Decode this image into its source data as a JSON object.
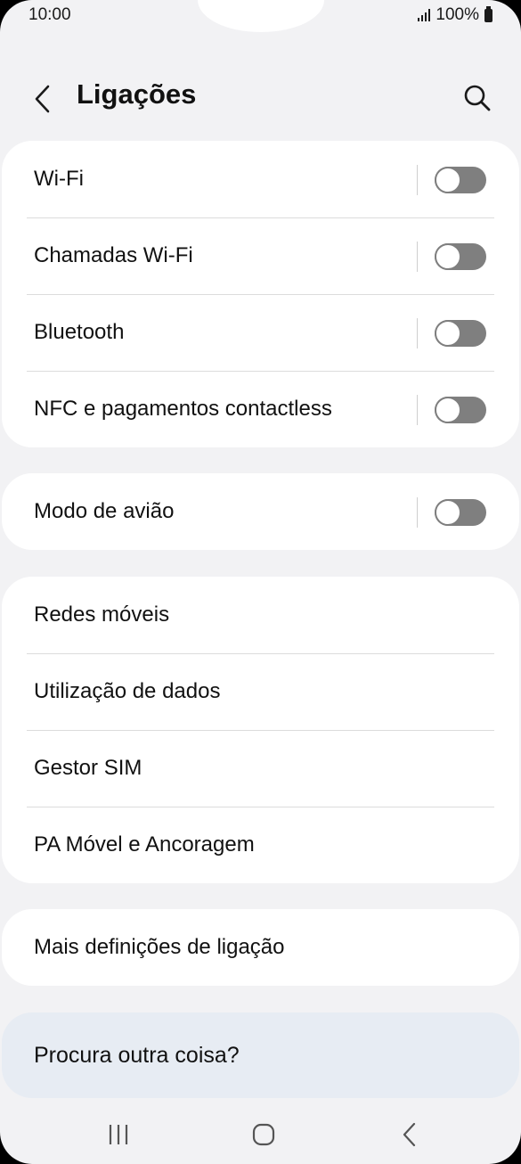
{
  "status_bar": {
    "time": "10:00",
    "battery": "100%"
  },
  "header": {
    "title": "Ligações"
  },
  "sections": [
    {
      "items": [
        {
          "label": "Wi-Fi",
          "toggle": false
        },
        {
          "label": "Chamadas Wi-Fi",
          "toggle": false
        },
        {
          "label": "Bluetooth",
          "toggle": false
        },
        {
          "label": "NFC e pagamentos contactless",
          "toggle": false
        }
      ]
    },
    {
      "items": [
        {
          "label": "Modo de avião",
          "toggle": false
        }
      ]
    },
    {
      "items": [
        {
          "label": "Redes móveis"
        },
        {
          "label": "Utilização de dados"
        },
        {
          "label": "Gestor SIM"
        },
        {
          "label": "PA Móvel e Ancoragem"
        }
      ]
    },
    {
      "items": [
        {
          "label": "Mais definições de ligação"
        }
      ]
    }
  ],
  "search_suggestion": {
    "label": "Procura outra coisa?"
  },
  "icons": {
    "back": "chevron-left-icon",
    "search": "search-icon",
    "nav_recents": "recents-icon",
    "nav_home": "home-icon",
    "nav_back": "nav-back-icon"
  },
  "colors": {
    "background": "#f2f2f4",
    "card": "#ffffff",
    "toggle_off": "#7f7f7f",
    "search_card": "#e7ecf3"
  }
}
